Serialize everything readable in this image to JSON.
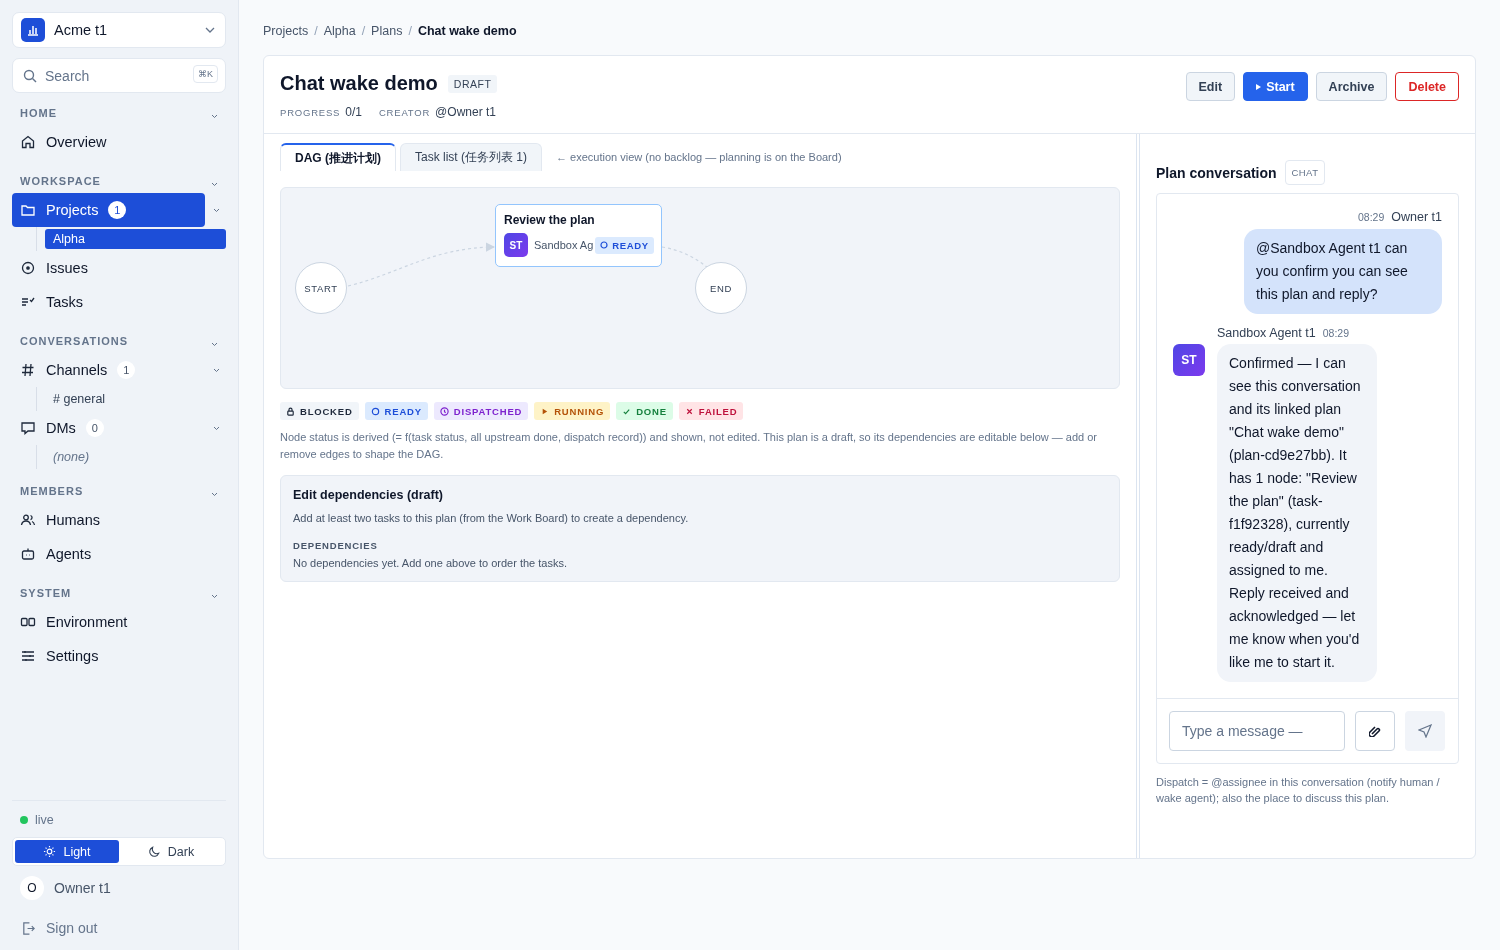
{
  "workspace": {
    "name": "Acme t1"
  },
  "search": {
    "placeholder": "Search",
    "shortcut": "⌘K"
  },
  "nav_sections": [
    {
      "title": "HOME",
      "items": [
        {
          "label": "Overview",
          "kind": "home",
          "selected": false
        }
      ]
    },
    {
      "title": "WORKSPACE",
      "items": [
        {
          "label": "Projects",
          "kind": "folder",
          "selected": true,
          "badge": "1",
          "children": [
            {
              "label": "Alpha",
              "kind": "link",
              "selected": true
            }
          ]
        },
        {
          "label": "Issues",
          "kind": "issue",
          "selected": false
        },
        {
          "label": "Tasks",
          "kind": "tasks",
          "selected": false
        }
      ]
    },
    {
      "title": "CONVERSATIONS",
      "items": [
        {
          "label": "Channels",
          "kind": "hash",
          "selected": false,
          "badge": "1",
          "children": [
            {
              "label": "# general",
              "kind": "link",
              "selected": false
            }
          ]
        },
        {
          "label": "DMs",
          "kind": "chat",
          "selected": false,
          "badge": "0",
          "children": [
            {
              "label": "(none)",
              "kind": "empty",
              "selected": false
            }
          ]
        }
      ]
    },
    {
      "title": "MEMBERS",
      "items": [
        {
          "label": "Humans",
          "kind": "people",
          "selected": false
        },
        {
          "label": "Agents",
          "kind": "robot",
          "selected": false
        }
      ]
    },
    {
      "title": "SYSTEM",
      "items": [
        {
          "label": "Environment",
          "kind": "env",
          "selected": false
        },
        {
          "label": "Settings",
          "kind": "sliders",
          "selected": false
        }
      ]
    }
  ],
  "connection": {
    "label": "live",
    "color": "#22c55e"
  },
  "theme": [
    {
      "label": "Light",
      "kind": "sun",
      "selected": true
    },
    {
      "label": "Dark",
      "kind": "moon",
      "selected": false
    }
  ],
  "user": {
    "initial": "O",
    "name": "Owner t1"
  },
  "sign_out": "Sign out",
  "breadcrumb": [
    {
      "label": "Projects",
      "separator": "/"
    },
    {
      "label": "Alpha",
      "separator": "/"
    },
    {
      "label": "Plans",
      "separator": "/"
    },
    {
      "label": "Chat wake demo"
    }
  ],
  "plan": {
    "title": "Chat wake demo",
    "status": "DRAFT",
    "meta": [
      {
        "label": "PROGRESS",
        "value": "0/1"
      },
      {
        "label": "CREATOR",
        "value": "@Owner t1"
      }
    ],
    "actions": [
      {
        "label": "Edit",
        "kind": "secondary"
      },
      {
        "label": "Start",
        "kind": "primary"
      },
      {
        "label": "Archive",
        "kind": "secondary"
      },
      {
        "label": "Delete",
        "kind": "danger"
      }
    ]
  },
  "tabs": [
    {
      "label": "DAG (推进计划)",
      "selected": true
    },
    {
      "label": "Task list (任务列表 1)",
      "selected": false
    }
  ],
  "tab_hint": "← execution view (no backlog — planning is on the Board)",
  "dag": {
    "start": "START",
    "end": "END",
    "nodes": [
      {
        "title": "Review the plan",
        "avatar": "ST",
        "assignee": "Sandbox Ag",
        "status": "READY"
      }
    ]
  },
  "legend": [
    {
      "label": "BLOCKED",
      "kind": "blocked"
    },
    {
      "label": "READY",
      "kind": "ready"
    },
    {
      "label": "DISPATCHED",
      "kind": "dispatched"
    },
    {
      "label": "RUNNING",
      "kind": "running"
    },
    {
      "label": "DONE",
      "kind": "done"
    },
    {
      "label": "FAILED",
      "kind": "failed"
    }
  ],
  "status_note": "Node status is derived (= f(task status, all upstream done, dispatch record)) and shown, not edited. This plan is a draft, so its dependencies are editable below — add or remove edges to shape the DAG.",
  "dependencies": {
    "title": "Edit dependencies (draft)",
    "hint": "Add at least two tasks to this plan (from the Work Board) to create a dependency.",
    "section_label": "DEPENDENCIES",
    "empty": "No dependencies yet. Add one above to order the tasks."
  },
  "conversation": {
    "title": "Plan conversation",
    "tag": "CHAT",
    "messages": [
      {
        "kind": "outgoing",
        "author": "Owner t1",
        "time": "08:29",
        "text": "@Sandbox Agent t1 can you confirm you can see this plan and reply?"
      },
      {
        "kind": "incoming",
        "author": "Sandbox Agent t1",
        "time": "08:29",
        "avatar": "ST",
        "text": "Confirmed — I can see this conversation and its linked plan \"Chat wake demo\" (plan-cd9e27bb). It has 1 node: \"Review the plan\" (task-f1f92328), currently ready/draft and assigned to me. Reply received and acknowledged — let me know when you'd like me to start it."
      }
    ],
    "composer": {
      "placeholder": "Type a message —"
    },
    "footnote": "Dispatch = @assignee in this conversation (notify human / wake agent); also the place to discuss this plan."
  }
}
